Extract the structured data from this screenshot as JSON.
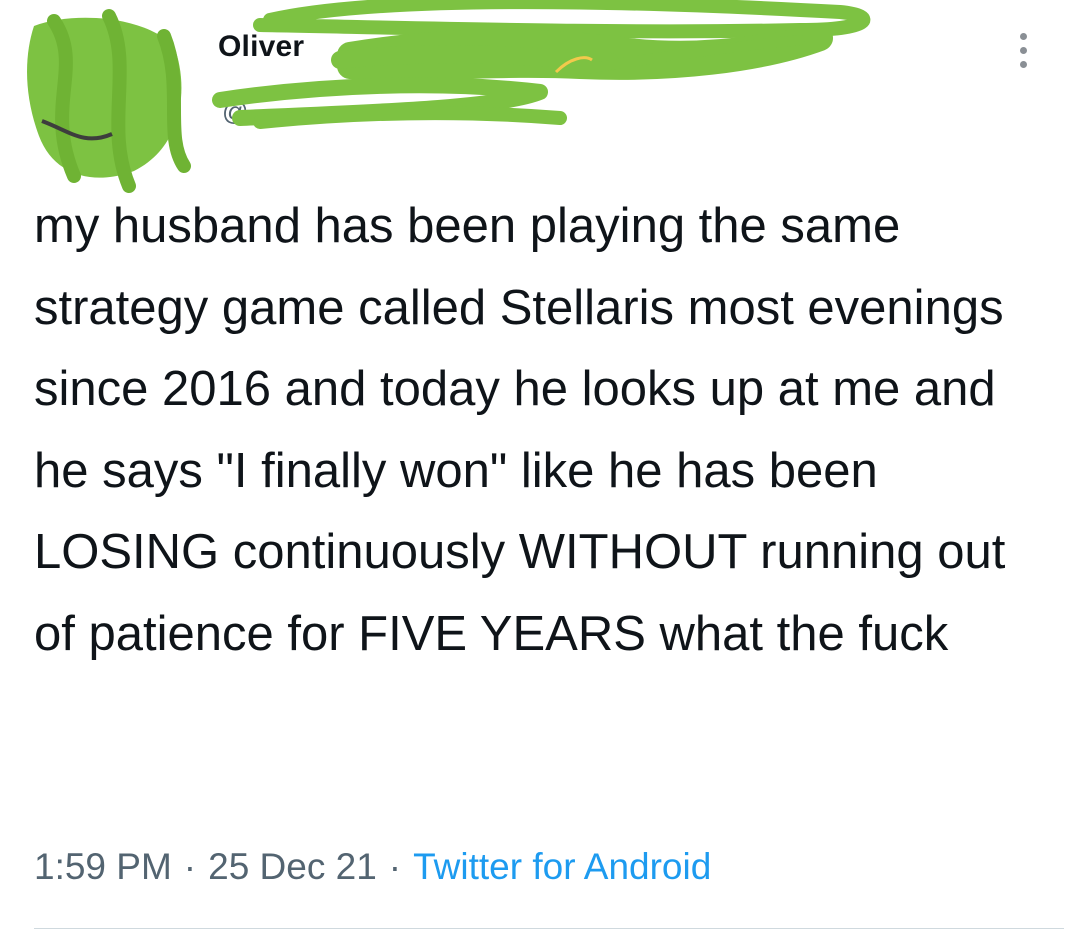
{
  "header": {
    "display_name": "Oliver",
    "handle": "@",
    "more_icon": "more-dots-vertical-icon",
    "scribble_color": "#7dc242"
  },
  "tweet": {
    "text": "my husband has been playing the same strategy game called Stellaris most evenings since 2016 and today he looks up at me and he says \"I finally won\" like he has been LOSING continuously WITHOUT running out of patience for FIVE YEARS what the fuck"
  },
  "meta": {
    "time": "1:59 PM",
    "separator": "·",
    "date": "25 Dec 21",
    "source": "Twitter for Android",
    "source_color": "#1d9bf0"
  }
}
